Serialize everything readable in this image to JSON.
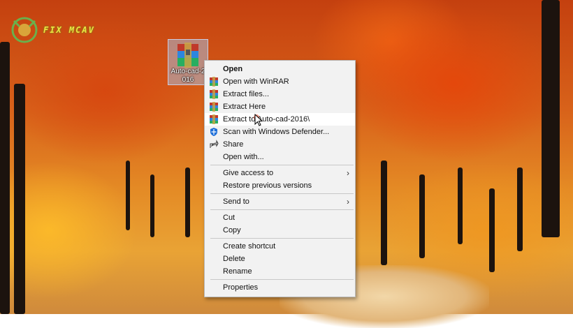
{
  "watermark": {
    "text": "FIX MCAV"
  },
  "desktop_icon": {
    "label": "Auto-cad-2016",
    "icon": "winrar-archive-icon"
  },
  "context_menu": {
    "items": [
      {
        "label": "Open",
        "bold": true
      },
      {
        "label": "Open with WinRAR",
        "icon": "winrar-icon"
      },
      {
        "label": "Extract files...",
        "icon": "winrar-icon"
      },
      {
        "label": "Extract Here",
        "icon": "winrar-icon"
      },
      {
        "label": "Extract to Auto-cad-2016\\",
        "icon": "winrar-icon",
        "highlighted": true
      },
      {
        "label": "Scan with Windows Defender...",
        "icon": "windows-defender-icon"
      },
      {
        "label": "Share",
        "icon": "share-icon"
      },
      {
        "label": "Open with..."
      },
      {
        "label": "Give access to",
        "submenu": true
      },
      {
        "label": "Restore previous versions"
      },
      {
        "label": "Send to",
        "submenu": true
      },
      {
        "label": "Cut"
      },
      {
        "label": "Copy"
      },
      {
        "label": "Create shortcut"
      },
      {
        "label": "Delete"
      },
      {
        "label": "Rename"
      },
      {
        "label": "Properties"
      }
    ]
  },
  "colors": {
    "menu_bg": "#f2f2f2",
    "highlight": "#ffffff",
    "watermark": "#f0e040"
  }
}
